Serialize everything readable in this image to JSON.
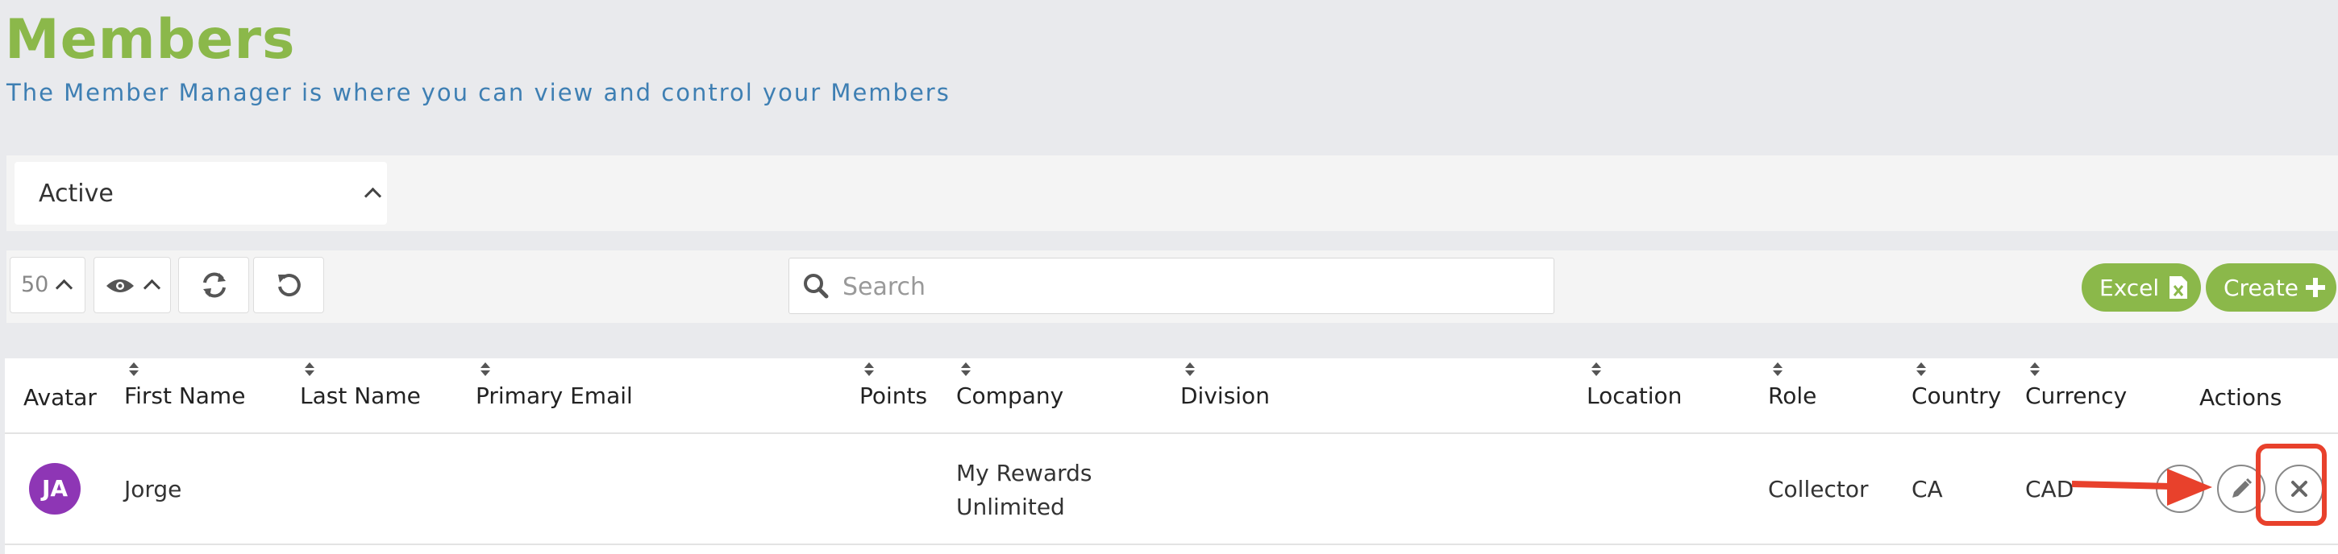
{
  "page": {
    "title": "Members",
    "subtitle": "The Member Manager is where you can view and control your Members"
  },
  "filter": {
    "status_value": "Active"
  },
  "toolbar": {
    "page_size": "50",
    "search_placeholder": "Search",
    "excel_label": "Excel",
    "create_label": "Create"
  },
  "table": {
    "columns": [
      "Avatar",
      "First Name",
      "Last Name",
      "Primary Email",
      "Points",
      "Company",
      "Division",
      "Location",
      "Role",
      "Country",
      "Currency",
      "Actions"
    ],
    "rows": [
      {
        "avatar_initials": "JA",
        "first_name": "Jorge",
        "last_name": "",
        "primary_email": "",
        "points": "",
        "company_line1": "My Rewards",
        "company_line2": "Unlimited",
        "division": "",
        "location": "",
        "role": "Collector",
        "country": "CA",
        "currency": "CAD"
      }
    ]
  },
  "colors": {
    "brand_green": "#8bb84a",
    "subtitle_blue": "#3e7fb3",
    "avatar_purple": "#8e36b5",
    "annotation_red": "#e8412c"
  }
}
